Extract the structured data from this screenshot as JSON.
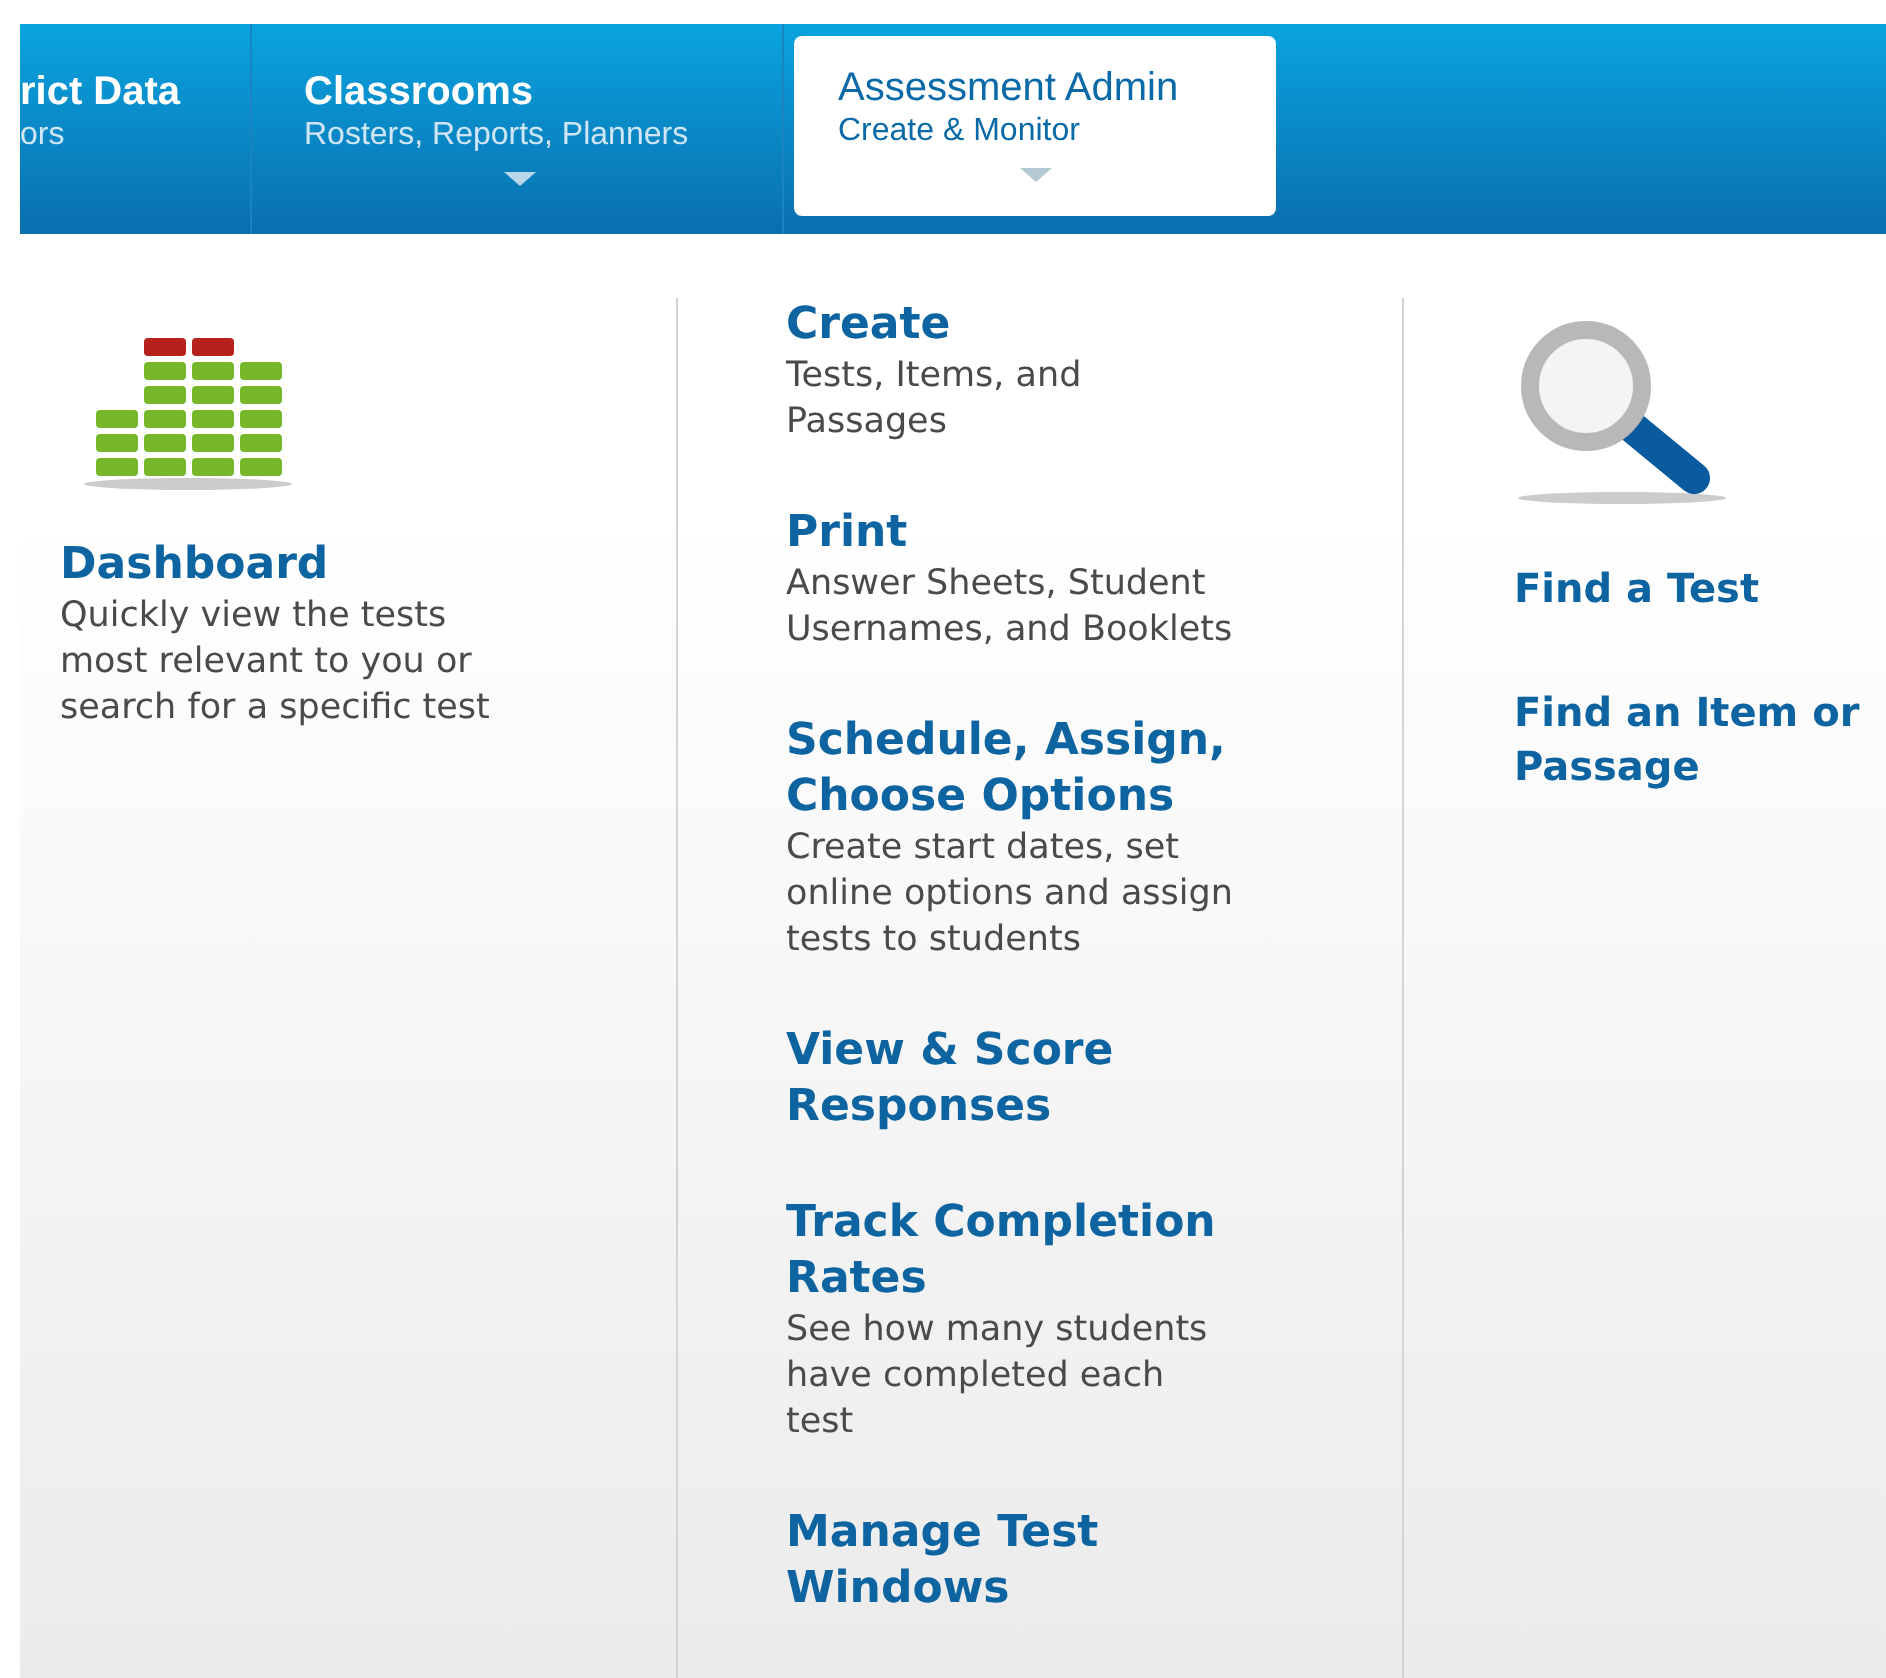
{
  "nav_tabs": [
    {
      "title": "rict Data",
      "subtitle": "ors",
      "selected": false,
      "caret": false
    },
    {
      "title": "Classrooms",
      "subtitle": "Rosters, Reports, Planners",
      "selected": false,
      "caret": true
    },
    {
      "title": "Assessment Admin",
      "subtitle": "Create & Monitor",
      "selected": true,
      "caret": true
    }
  ],
  "dashboard": {
    "title": "Dashboard",
    "description": "Quickly view the tests most relevant to you or search for a specific test"
  },
  "actions": [
    {
      "title": "Create",
      "description": "Tests, Items, and Passages"
    },
    {
      "title": "Print",
      "description": "Answer Sheets, Student Usernames, and Booklets"
    },
    {
      "title": "Schedule, Assign, Choose Options",
      "description": "Create start dates, set online options and assign tests to students"
    },
    {
      "title": "View & Score Responses"
    },
    {
      "title": "Track Completion Rates",
      "description": "See how many students have completed each test"
    },
    {
      "title": "Manage Test Windows"
    }
  ],
  "find_links": [
    "Find a Test",
    "Find an Item or Passage"
  ]
}
